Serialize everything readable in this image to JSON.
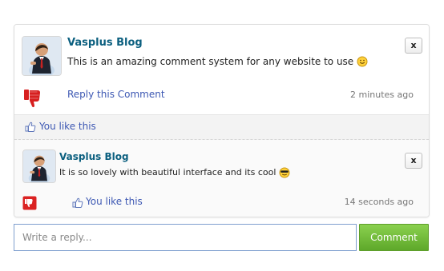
{
  "main_comment": {
    "author": "Vasplus Blog",
    "text": "This is an amazing comment system for any website to use",
    "emoji": "smile",
    "delete_label": "x",
    "reply_label": "Reply this Comment",
    "time": "2 minutes ago"
  },
  "like_bar": {
    "label": "You like this"
  },
  "reply_comment": {
    "author": "Vasplus Blog",
    "text": "It is so lovely with beautiful interface and its cool",
    "emoji": "cool",
    "delete_label": "x",
    "like_label": "You like this",
    "time": "14 seconds ago"
  },
  "reply_form": {
    "placeholder": "Write a reply...",
    "button_label": "Comment"
  },
  "colors": {
    "author": "#0b5f7f",
    "link": "#3d58b3",
    "button": "#6dbb3a",
    "thumb_down": "#d71f1f"
  }
}
